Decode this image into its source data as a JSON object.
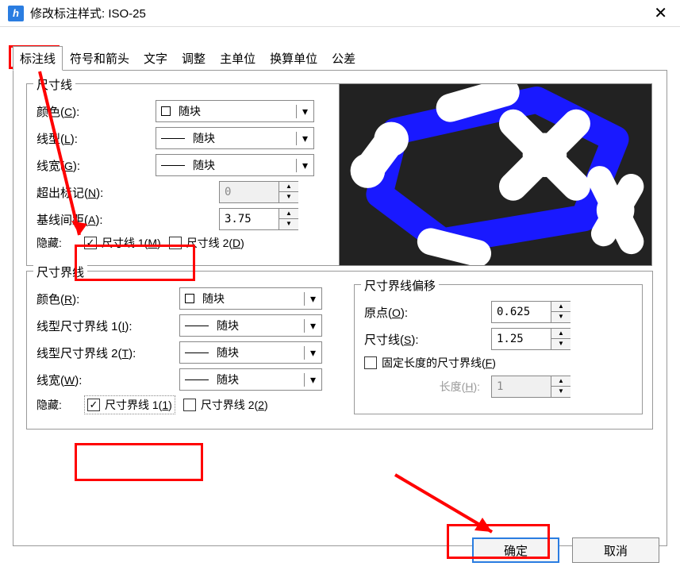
{
  "window": {
    "title": "修改标注样式: ISO-25"
  },
  "tabs": [
    "标注线",
    "符号和箭头",
    "文字",
    "调整",
    "主单位",
    "换算单位",
    "公差"
  ],
  "dimline": {
    "legend": "尺寸线",
    "color_lbl": "颜色(C):",
    "color_val": "随块",
    "linetype_lbl": "线型(L):",
    "linetype_val": "随块",
    "lineweight_lbl": "线宽(G):",
    "lineweight_val": "随块",
    "extend_lbl": "超出标记(N):",
    "extend_val": "0",
    "baseline_lbl": "基线间距(A):",
    "baseline_val": "3.75",
    "hide_lbl": "隐藏:",
    "chk1": "尺寸线 1(M)",
    "chk2": "尺寸线 2(D)"
  },
  "extline": {
    "legend": "尺寸界线",
    "color_lbl": "颜色(R):",
    "color_val": "随块",
    "lt1_lbl": "线型尺寸界线 1(I):",
    "lt1_val": "随块",
    "lt2_lbl": "线型尺寸界线 2(T):",
    "lt2_val": "随块",
    "lw_lbl": "线宽(W):",
    "lw_val": "随块",
    "hide_lbl": "隐藏:",
    "chk1": "尺寸界线 1(1)",
    "chk2": "尺寸界线 2(2)",
    "offset_legend": "尺寸界线偏移",
    "origin_lbl": "原点(O):",
    "origin_val": "0.625",
    "dimline_lbl": "尺寸线(S):",
    "dimline_val": "1.25",
    "fixed_chk": "固定长度的尺寸界线(F)",
    "length_lbl": "长度(H):",
    "length_val": "1"
  },
  "buttons": {
    "ok": "确定",
    "cancel": "取消"
  }
}
